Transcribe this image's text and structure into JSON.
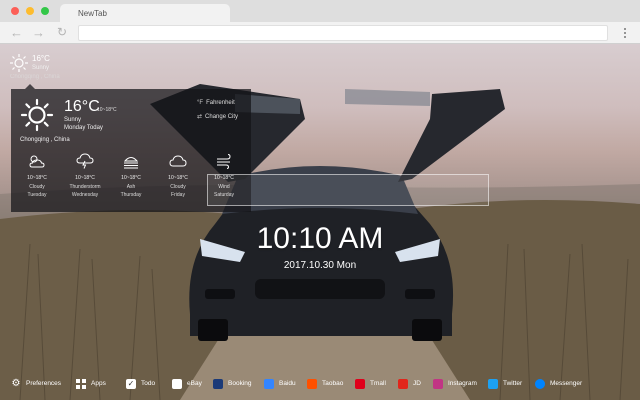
{
  "browser": {
    "tab_title": "NewTab",
    "nav": {
      "back": "←",
      "forward": "→",
      "reload": "↻"
    }
  },
  "weather_mini": {
    "temp": "16°C",
    "condition": "Sunny",
    "location": "Chongqing , China"
  },
  "weather": {
    "temp": "16°C",
    "range": "10~18°C",
    "condition": "Sunny",
    "day": "Monday Today",
    "city": "Chongqing , China",
    "unit_option": "Fahrenheit",
    "change_city": "Change City",
    "forecast": [
      {
        "icon": "cloudy-sun-icon",
        "range": "10~18°C",
        "condition": "Cloudy",
        "day": "Tuesday"
      },
      {
        "icon": "thunderstorm-icon",
        "range": "10~18°C",
        "condition": "Thunderstorm",
        "day": "Wednesday"
      },
      {
        "icon": "ash-icon",
        "range": "10~18°C",
        "condition": "Ash",
        "day": "Thursday"
      },
      {
        "icon": "cloud-icon",
        "range": "10~18°C",
        "condition": "Cloudy",
        "day": "Friday"
      },
      {
        "icon": "wind-icon",
        "range": "10~18°C",
        "condition": "Wind",
        "day": "Saturday"
      }
    ]
  },
  "clock": {
    "time": "10:10 AM",
    "date": "2017.10.30 Mon"
  },
  "bottombar": [
    {
      "label": "Preferences",
      "icon": "gear-icon",
      "color": "transparent"
    },
    {
      "label": "Apps",
      "icon": "grid-icon",
      "color": "transparent"
    },
    {
      "label": "Todo",
      "icon": "checkbox-icon",
      "color": "#ffffff"
    },
    {
      "label": "eBay",
      "icon": "ebay-icon",
      "color": "#ffffff"
    },
    {
      "label": "Booking",
      "icon": "booking-icon",
      "color": "#1b3a78"
    },
    {
      "label": "Baidu",
      "icon": "baidu-icon",
      "color": "#3385ff"
    },
    {
      "label": "Taobao",
      "icon": "taobao-icon",
      "color": "#ff5000"
    },
    {
      "label": "Tmall",
      "icon": "tmall-icon",
      "color": "#e0001b"
    },
    {
      "label": "JD",
      "icon": "jd-icon",
      "color": "#e1251b"
    },
    {
      "label": "Instagram",
      "icon": "instagram-icon",
      "color": "#c13584"
    },
    {
      "label": "Twitter",
      "icon": "twitter-icon",
      "color": "#1da1f2"
    },
    {
      "label": "Messenger",
      "icon": "messenger-icon",
      "color": "#0084ff"
    }
  ]
}
